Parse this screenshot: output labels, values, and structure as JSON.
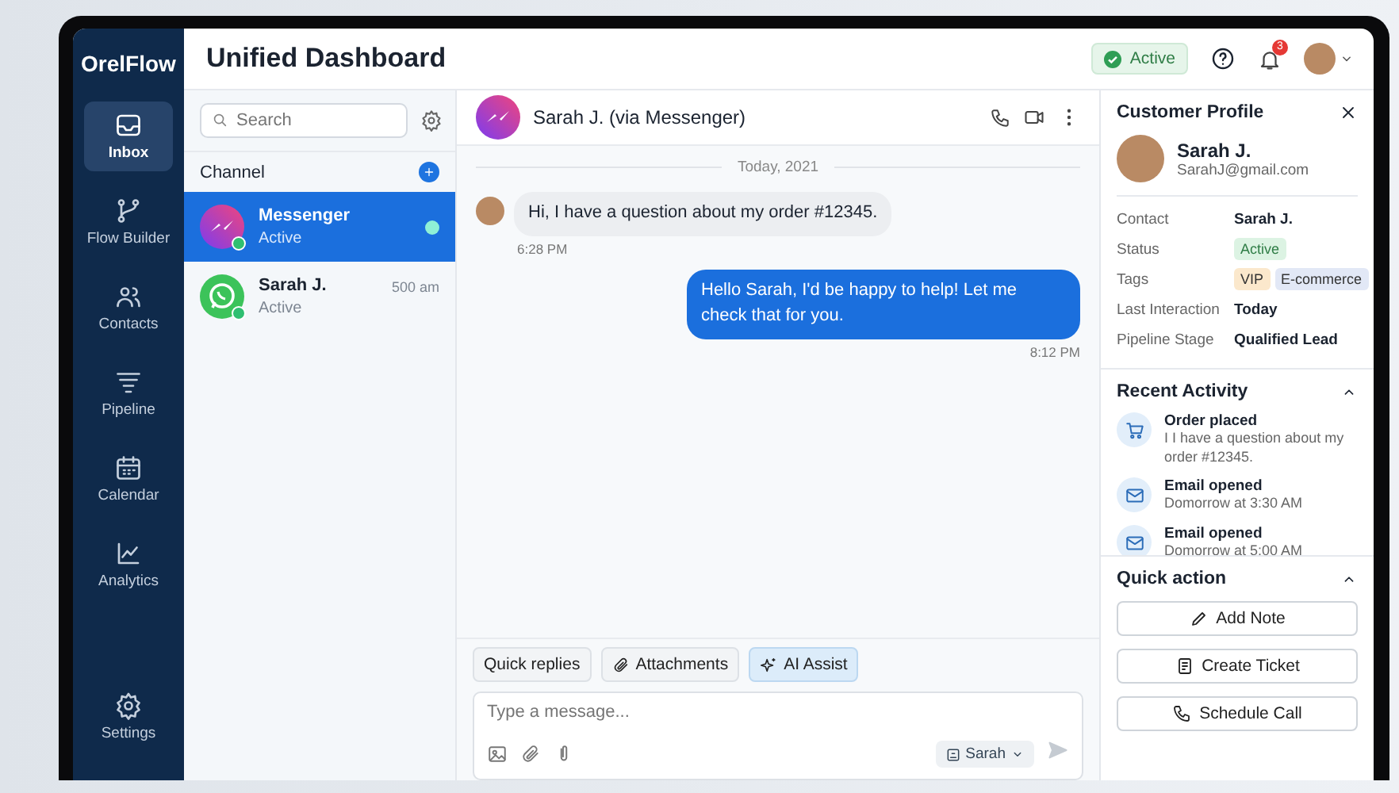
{
  "brand": "OrelFlow",
  "nav": [
    {
      "label": "Inbox",
      "selected": true
    },
    {
      "label": "Flow Builder",
      "selected": false
    },
    {
      "label": "Contacts",
      "selected": false
    },
    {
      "label": "Pipeline",
      "selected": false
    },
    {
      "label": "Calendar",
      "selected": false
    },
    {
      "label": "Analytics",
      "selected": false
    }
  ],
  "nav_footer": {
    "label": "Settings"
  },
  "header": {
    "title": "Unified Dashboard",
    "status": "Active",
    "notifications": "3"
  },
  "channels": {
    "search_placeholder": "Search",
    "heading": "Channel",
    "items": [
      {
        "kind": "messenger",
        "name": "Messenger",
        "status": "Active",
        "selected": true,
        "unread": true
      },
      {
        "kind": "whatsapp",
        "name": "Sarah J.",
        "status": "Active",
        "time": "500 am",
        "selected": false,
        "unread": false
      }
    ]
  },
  "chat": {
    "title": "Sarah J. (via Messenger)",
    "date": "Today, 2021",
    "messages": [
      {
        "kind": "incoming",
        "text": "Hi, I have a question about my order #12345.",
        "time": "6:28 PM"
      },
      {
        "kind": "outgoing",
        "text": "Hello Sarah, I'd be happy to help! Let me check that for you.",
        "time": "8:12 PM"
      }
    ],
    "tools": [
      {
        "label": "Quick replies",
        "selected": false
      },
      {
        "label": "Attachments",
        "selected": false
      },
      {
        "label": "AI Assist",
        "selected": true
      }
    ],
    "composer": {
      "placeholder": "Type a message...",
      "sender": "Sarah"
    }
  },
  "profile": {
    "title": "Customer Profile",
    "name": "Sarah J.",
    "email": "SarahJ@gmail.com",
    "fields": [
      {
        "kind": "text",
        "label": "Contact",
        "value": "Sarah J."
      },
      {
        "kind": "badge",
        "label": "Status",
        "value": "Active",
        "color": "#dcf3e3"
      },
      {
        "kind": "tags",
        "label": "Tags",
        "tags": [
          {
            "label": "VIP",
            "color": "#fbe8cc"
          },
          {
            "label": "E-commerce",
            "color": "#e2e8f6"
          }
        ]
      },
      {
        "kind": "text",
        "label": "Last Interaction",
        "value": "Today"
      },
      {
        "kind": "text",
        "label": "Pipeline Stage",
        "value": "Qualified Lead"
      }
    ],
    "activity_title": "Recent Activity",
    "activity": [
      {
        "kind": "order",
        "title": "Order placed",
        "detail": "I I have a question about my order #12345."
      },
      {
        "kind": "email",
        "title": "Email opened",
        "detail": "Domorrow at 3:30 AM"
      },
      {
        "kind": "email",
        "title": "Email opened",
        "detail": "Domorrow at 5:00 AM"
      }
    ],
    "actions_title": "Quick action",
    "actions": [
      "Add Note",
      "Create Ticket",
      "Schedule Call"
    ]
  }
}
